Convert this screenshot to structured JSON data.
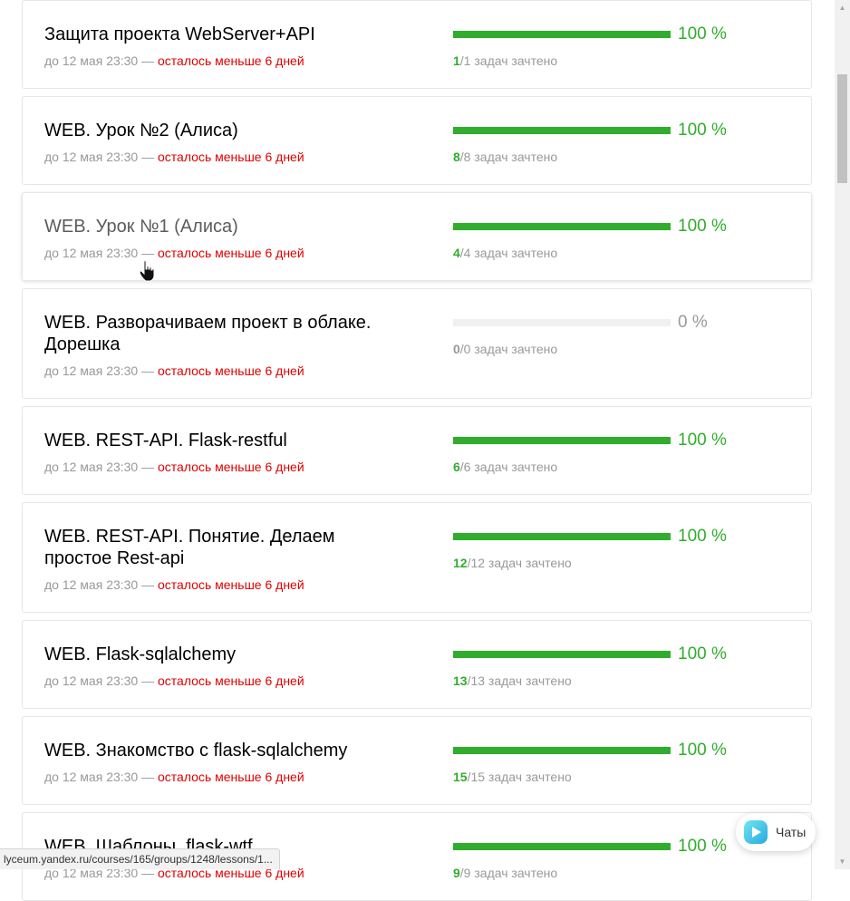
{
  "lessons": [
    {
      "title": "Защита проекта WebServer+API",
      "deadline": "до 12 мая 23:30 — ",
      "warning": "осталось меньше 6 дней",
      "progress": 1.0,
      "percent": "100 %",
      "done": "1",
      "tasks": "/1 задач зачтено"
    },
    {
      "title": "WEB. Урок №2 (Алиса)",
      "deadline": "до 12 мая 23:30 — ",
      "warning": "осталось меньше 6 дней",
      "progress": 1.0,
      "percent": "100 %",
      "done": "8",
      "tasks": "/8 задач зачтено"
    },
    {
      "title": "WEB. Урок №1 (Алиса)",
      "deadline": "до 12 мая 23:30 — ",
      "warning": "осталось меньше 6 дней",
      "progress": 1.0,
      "percent": "100 %",
      "done": "4",
      "tasks": "/4 задач зачтено"
    },
    {
      "title": "WEB. Разворачиваем проект в облаке. Дорешка",
      "deadline": "до 12 мая 23:30 — ",
      "warning": "осталось меньше 6 дней",
      "progress": 0.0,
      "percent": "0 %",
      "done": "0",
      "tasks": "/0 задач зачтено"
    },
    {
      "title": "WEB. REST-API. Flask-restful",
      "deadline": "до 12 мая 23:30 — ",
      "warning": "осталось меньше 6 дней",
      "progress": 1.0,
      "percent": "100 %",
      "done": "6",
      "tasks": "/6 задач зачтено"
    },
    {
      "title": "WEB. REST-API. Понятие. Делаем простое Rest-api",
      "deadline": "до 12 мая 23:30 — ",
      "warning": "осталось меньше 6 дней",
      "progress": 1.0,
      "percent": "100 %",
      "done": "12",
      "tasks": "/12 задач зачтено"
    },
    {
      "title": "WEB. Flask-sqlalchemy",
      "deadline": "до 12 мая 23:30 — ",
      "warning": "осталось меньше 6 дней",
      "progress": 1.0,
      "percent": "100 %",
      "done": "13",
      "tasks": "/13 задач зачтено"
    },
    {
      "title": "WEB. Знакомство с flask-sqlalchemy",
      "deadline": "до 12 мая 23:30 — ",
      "warning": "осталось меньше 6 дней",
      "progress": 1.0,
      "percent": "100 %",
      "done": "15",
      "tasks": "/15 задач зачтено"
    },
    {
      "title": "WEB. Шаблоны. flask-wtf",
      "deadline": "до 12 мая 23:30 — ",
      "warning": "осталось меньше 6 дней",
      "progress": 1.0,
      "percent": "100 %",
      "done": "9",
      "tasks": "/9 задач зачтено"
    }
  ],
  "chat": {
    "label": "Чаты",
    "icon": "chat-bubble-icon"
  },
  "status_url": "lyceum.yandex.ru/courses/165/groups/1248/lessons/1...",
  "colors": {
    "accent": "#30ad2d",
    "warning": "#e00000",
    "muted": "#999999"
  }
}
